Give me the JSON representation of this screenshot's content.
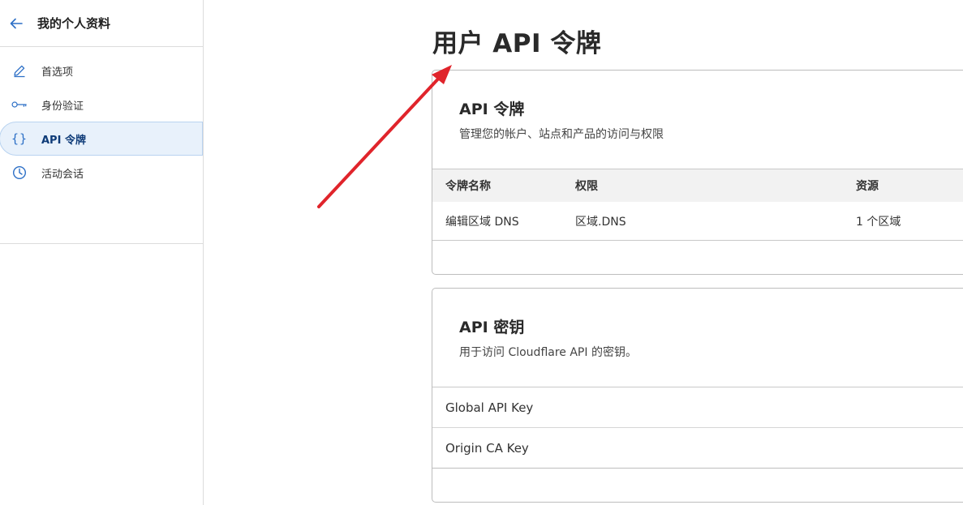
{
  "sidebar": {
    "title": "我的个人资料",
    "items": [
      {
        "label": "首选项",
        "icon": "pencil-icon"
      },
      {
        "label": "身份验证",
        "icon": "key-icon"
      },
      {
        "label": "API 令牌",
        "icon": "braces-icon",
        "active": true
      },
      {
        "label": "活动会话",
        "icon": "clock-icon"
      }
    ]
  },
  "main": {
    "page_title": "用户 API 令牌",
    "tokens_card": {
      "title": "API 令牌",
      "description": "管理您的帐户、站点和产品的访问与权限",
      "columns": [
        "令牌名称",
        "权限",
        "资源"
      ],
      "rows": [
        {
          "name": "编辑区域 DNS",
          "permission": "区域.DNS",
          "resource": "1 个区域"
        }
      ]
    },
    "keys_card": {
      "title": "API 密钥",
      "description": "用于访问 Cloudflare API 的密钥。",
      "keys": [
        "Global API Key",
        "Origin CA Key"
      ]
    }
  },
  "colors": {
    "accent": "#2c6fc6",
    "active_bg": "#e8f1fb",
    "annotation_arrow": "#e0242b"
  }
}
